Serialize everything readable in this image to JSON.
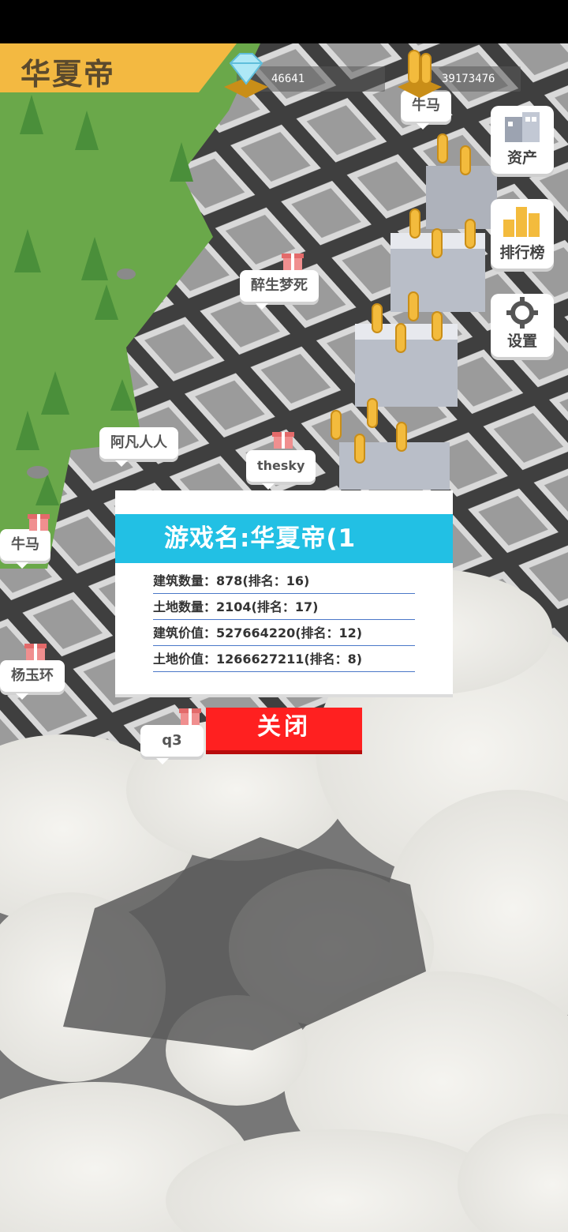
{
  "header": {
    "player_name": "华夏帝",
    "gems": "46641",
    "coins": "39173476",
    "coin_owner_tag": "牛马"
  },
  "side_menu": {
    "assets": "资产",
    "ranking": "排行榜",
    "settings": "设置"
  },
  "map_tags": [
    "醉生梦死",
    "阿凡人人",
    "thesky",
    "牛马",
    "杨玉环",
    "q3"
  ],
  "dialog": {
    "title": "游戏名:华夏帝(1",
    "rows": [
      {
        "label": "建筑数量：",
        "value": "878(排名：16)"
      },
      {
        "label": "土地数量：",
        "value": "2104(排名：17)"
      },
      {
        "label": "建筑价值：",
        "value": "527664220(排名：12)"
      },
      {
        "label": "土地价值：",
        "value": "1266627211(排名：8)"
      }
    ],
    "close_label": "关闭"
  },
  "colors": {
    "banner": "#f3b941",
    "dialog_header": "#22c0e4",
    "close_button": "#ff2020",
    "grass": "#6aa84a"
  },
  "icons": [
    "diamond-icon",
    "gold-coin-icon",
    "buildings-icon",
    "bar-chart-icon",
    "gear-icon",
    "gift-box-icon"
  ]
}
